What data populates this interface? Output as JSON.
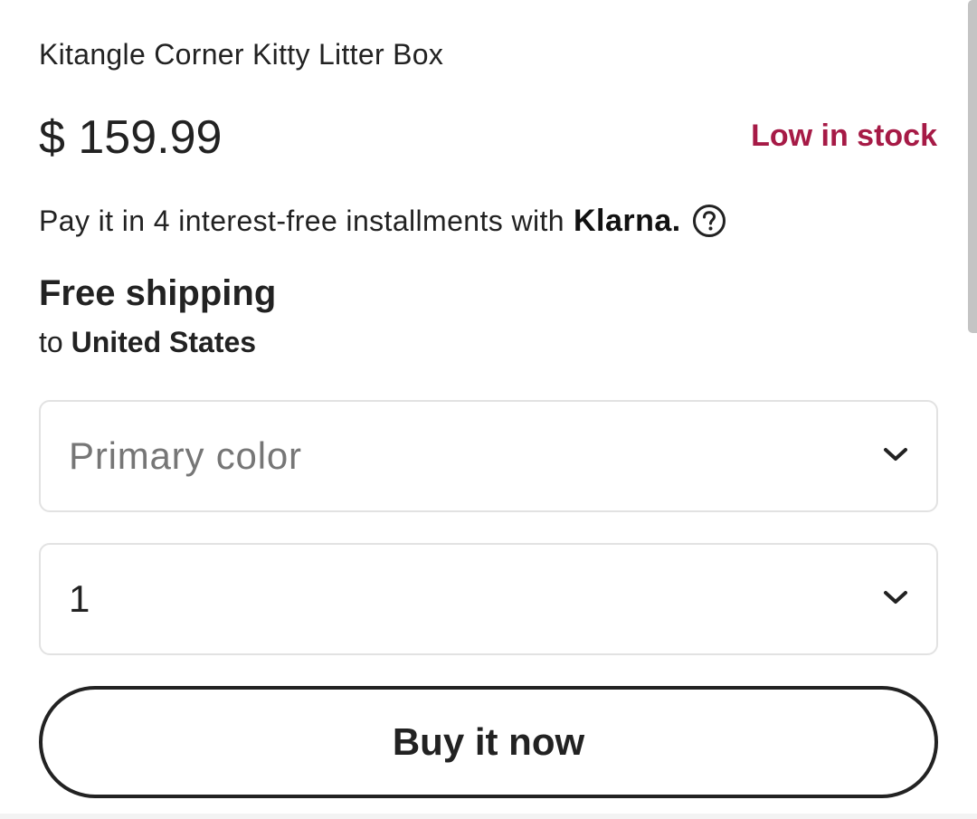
{
  "product": {
    "title": "Kitangle Corner Kitty Litter Box",
    "price": "$ 159.99",
    "stock_status": "Low in stock",
    "stock_color": "#a61a46"
  },
  "payment": {
    "installments_text": "Pay it in 4 interest-free installments with",
    "provider_logo": "Klarna.",
    "help_icon": "question-circle-icon"
  },
  "shipping": {
    "headline": "Free shipping",
    "prefix": "to",
    "destination": "United States"
  },
  "options": {
    "color_placeholder": "Primary color",
    "quantity_value": "1",
    "dropdown_icon": "chevron-down-icon"
  },
  "actions": {
    "buy_now_label": "Buy it now"
  }
}
